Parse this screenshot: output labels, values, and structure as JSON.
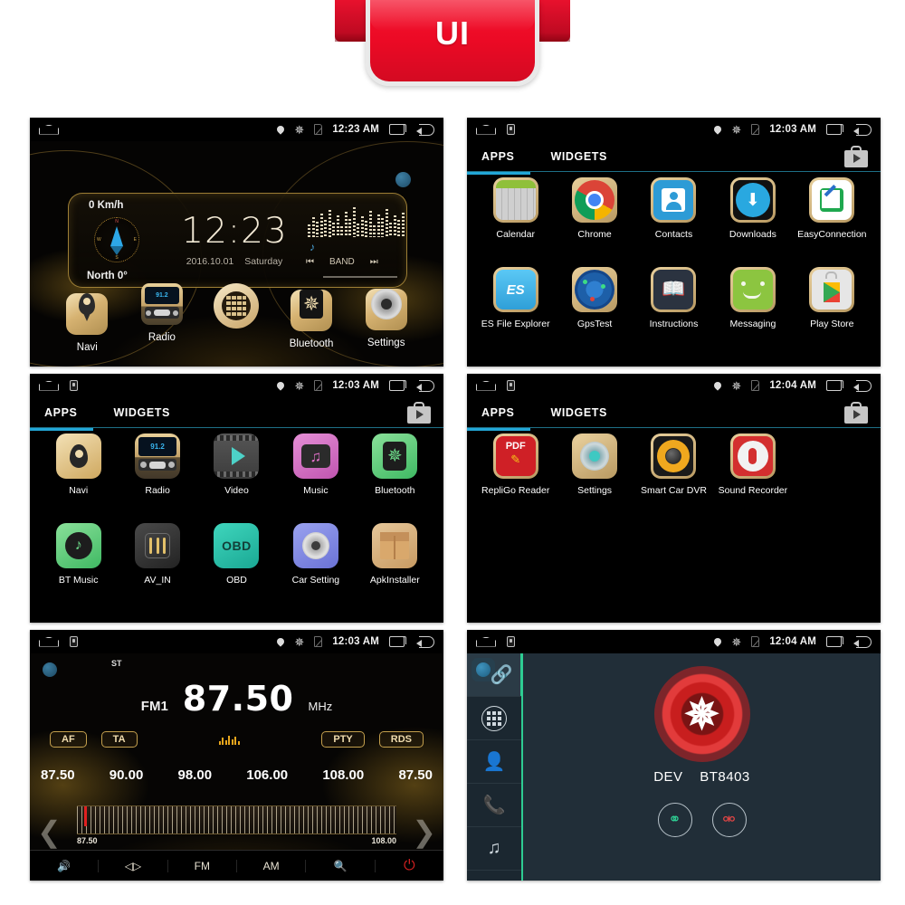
{
  "banner": {
    "label": "UI",
    "color": "#ec0a25"
  },
  "panels": [
    {
      "id": "home",
      "statusbar": {
        "time": "12:23 AM",
        "icons": [
          "home-icon",
          "location-pin-icon",
          "bluetooth-icon",
          "sim-card-icon",
          "recents-icon",
          "back-icon"
        ]
      },
      "widget": {
        "speed": "0 Km/h",
        "heading": "North 0°",
        "clock": "12:23",
        "date": "2016.10.01",
        "weekday": "Saturday",
        "band_label": "BAND",
        "prev_label": "⏮",
        "next_label": "⏭"
      },
      "dock": [
        {
          "label": "Navi",
          "icon": "navi-icon"
        },
        {
          "label": "Radio",
          "icon": "radio-icon",
          "display": "91.2"
        },
        {
          "label": "",
          "icon": "app-drawer-icon"
        },
        {
          "label": "Bluetooth",
          "icon": "bluetooth-icon"
        },
        {
          "label": "Settings",
          "icon": "settings-gear-icon"
        }
      ]
    },
    {
      "id": "apps-page-1",
      "statusbar": {
        "time": "12:03 AM"
      },
      "tabs": [
        {
          "label": "APPS",
          "active": true
        },
        {
          "label": "WIDGETS",
          "active": false
        }
      ],
      "shop_icon": "play-store-bag-icon",
      "apps": [
        {
          "label": "Calendar",
          "icon": "calendar-icon"
        },
        {
          "label": "Chrome",
          "icon": "chrome-icon"
        },
        {
          "label": "Contacts",
          "icon": "contacts-icon"
        },
        {
          "label": "Downloads",
          "icon": "downloads-icon"
        },
        {
          "label": "EasyConnection",
          "icon": "easyconnection-icon"
        },
        {
          "label": "ES File Explorer",
          "icon": "es-file-explorer-icon"
        },
        {
          "label": "GpsTest",
          "icon": "gpstest-icon"
        },
        {
          "label": "Instructions",
          "icon": "instructions-icon"
        },
        {
          "label": "Messaging",
          "icon": "messaging-icon"
        },
        {
          "label": "Play Store",
          "icon": "play-store-icon"
        }
      ]
    },
    {
      "id": "apps-page-2",
      "statusbar": {
        "time": "12:03 AM"
      },
      "tabs": [
        {
          "label": "APPS",
          "active": true
        },
        {
          "label": "WIDGETS",
          "active": false
        }
      ],
      "apps": [
        {
          "label": "Navi",
          "icon": "navi-icon"
        },
        {
          "label": "Radio",
          "icon": "radio-icon",
          "display": "91.2"
        },
        {
          "label": "Video",
          "icon": "video-icon"
        },
        {
          "label": "Music",
          "icon": "music-icon"
        },
        {
          "label": "Bluetooth",
          "icon": "bluetooth-icon"
        },
        {
          "label": "BT Music",
          "icon": "bt-music-icon"
        },
        {
          "label": "AV_IN",
          "icon": "av-in-icon"
        },
        {
          "label": "OBD",
          "icon": "obd-icon",
          "display": "OBD"
        },
        {
          "label": "Car Setting",
          "icon": "car-setting-icon"
        },
        {
          "label": "ApkInstaller",
          "icon": "apk-installer-icon"
        }
      ]
    },
    {
      "id": "apps-page-3",
      "statusbar": {
        "time": "12:04 AM"
      },
      "tabs": [
        {
          "label": "APPS",
          "active": true
        },
        {
          "label": "WIDGETS",
          "active": false
        }
      ],
      "apps": [
        {
          "label": "RepliGo Reader",
          "icon": "repligo-reader-icon",
          "display": "PDF"
        },
        {
          "label": "Settings",
          "icon": "settings-gear-icon"
        },
        {
          "label": "Smart Car DVR",
          "icon": "smart-car-dvr-icon"
        },
        {
          "label": "Sound Recorder",
          "icon": "sound-recorder-icon"
        }
      ]
    },
    {
      "id": "radio",
      "statusbar": {
        "time": "12:03 AM"
      },
      "stereo_label": "ST",
      "band": "FM1",
      "frequency": "87.50",
      "unit": "MHz",
      "buttons": [
        "AF",
        "TA",
        "PTY",
        "RDS"
      ],
      "presets": [
        "87.50",
        "90.00",
        "98.00",
        "106.00",
        "108.00",
        "87.50"
      ],
      "tuner": {
        "start": "87.50",
        "end": "108.00",
        "cursor_value": "87.50"
      },
      "toolbar": [
        {
          "label": "",
          "icon": "volume-icon"
        },
        {
          "label": "",
          "icon": "stereo-balance-icon"
        },
        {
          "label": "FM",
          "icon": "fm-band-button"
        },
        {
          "label": "AM",
          "icon": "am-band-button"
        },
        {
          "label": "",
          "icon": "search-scan-icon"
        },
        {
          "label": "",
          "icon": "power-icon"
        }
      ]
    },
    {
      "id": "bluetooth",
      "statusbar": {
        "time": "12:04 AM"
      },
      "sidebar": [
        {
          "icon": "bt-pair-link-icon",
          "active": true
        },
        {
          "icon": "dialpad-icon",
          "active": false
        },
        {
          "icon": "contacts-person-icon",
          "active": false
        },
        {
          "icon": "call-history-icon",
          "active": false
        },
        {
          "icon": "bt-music-note-icon",
          "active": false
        }
      ],
      "device_prefix": "DEV",
      "device_name": "BT8403",
      "actions": [
        {
          "icon": "connect-link-icon",
          "glyph": "⚭",
          "color": "#2ecc92"
        },
        {
          "icon": "disconnect-link-icon",
          "glyph": "⚮",
          "color": "#e04545"
        }
      ]
    }
  ]
}
